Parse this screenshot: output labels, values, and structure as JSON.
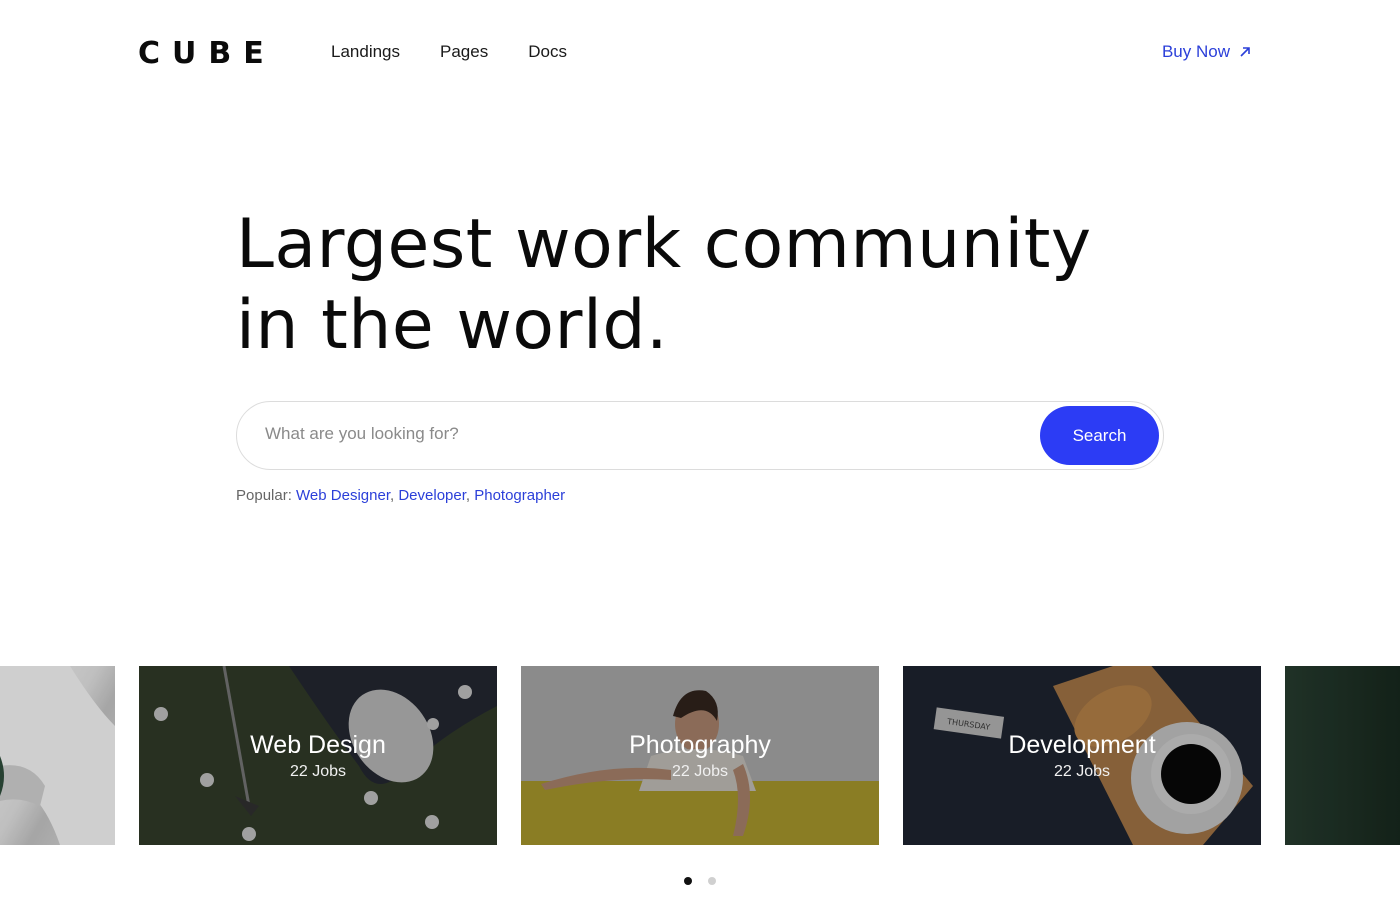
{
  "header": {
    "logo": "CUBE",
    "nav": [
      "Landings",
      "Pages",
      "Docs"
    ],
    "buy_label": "Buy Now"
  },
  "hero": {
    "title_line1": "Largest work community",
    "title_line2": "in the world."
  },
  "search": {
    "placeholder": "What are you looking for?",
    "button": "Search"
  },
  "popular": {
    "label": "Popular:",
    "links": [
      "Web Designer",
      "Developer",
      "Photographer"
    ]
  },
  "categories": [
    {
      "name": "Web Design",
      "jobs": "22 Jobs"
    },
    {
      "name": "Photography",
      "jobs": "22 Jobs"
    },
    {
      "name": "Development",
      "jobs": "22 Jobs"
    }
  ],
  "development_tag": "THURSDAY",
  "carousel": {
    "pages": 2,
    "active_page": 1
  },
  "colors": {
    "accent": "#2c3cf5",
    "link": "#2b3fd9"
  }
}
